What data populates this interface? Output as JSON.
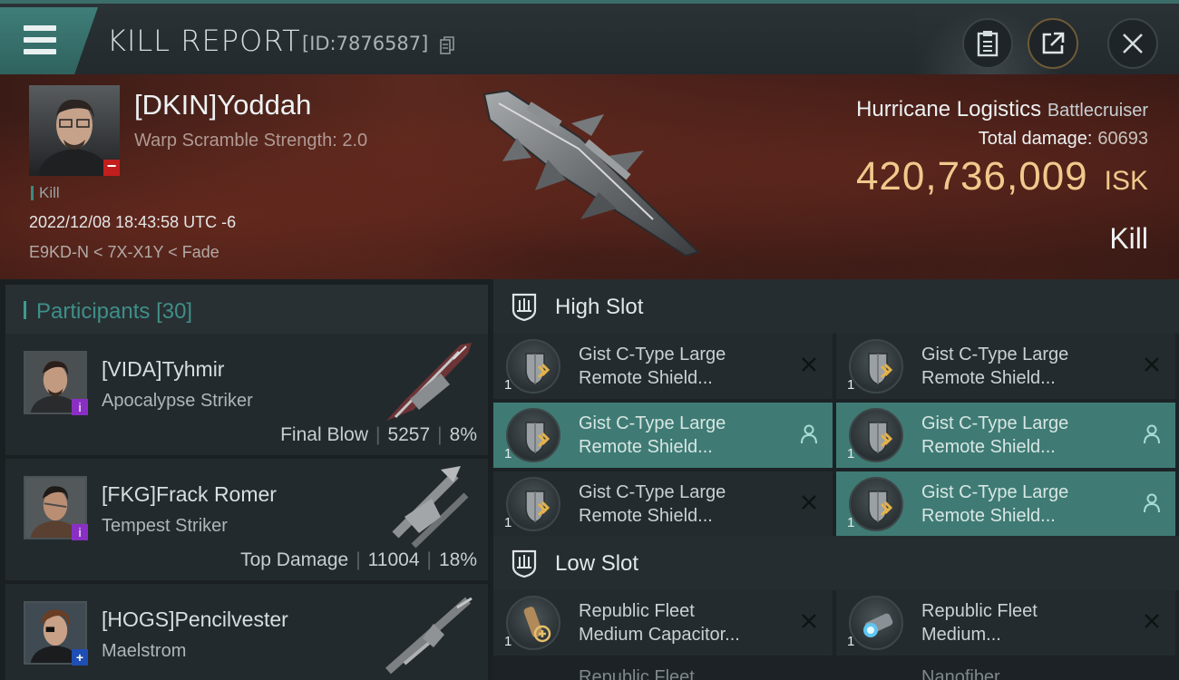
{
  "header": {
    "title": "KILL REPORT",
    "report_id": "[ID:7876587]",
    "icons": [
      "menu-icon",
      "copy-icon",
      "clipboard-icon",
      "export-icon",
      "close-icon"
    ]
  },
  "victim": {
    "name": "[DKIN]Yoddah",
    "warp_scramble": "Warp Scramble Strength: 2.0",
    "kill_tag": "Kill",
    "datetime": "2022/12/08 18:43:58 UTC -6",
    "location": "E9KD-N < 7X-X1Y < Fade",
    "ship_name": "Hurricane Logistics",
    "ship_class": "Battlecruiser",
    "total_damage_label": "Total damage:",
    "total_damage": "60693",
    "isk_value": "420,736,009",
    "isk_unit": "ISK",
    "result": "Kill"
  },
  "participants": {
    "label": "Participants",
    "count": "[30]",
    "rows": [
      {
        "name": "[VIDA]Tyhmir",
        "ship": "Apocalypse Striker",
        "tag": "Final Blow",
        "damage": "5257",
        "percent": "8%",
        "badge": "purple"
      },
      {
        "name": "[FKG]Frack Romer",
        "ship": "Tempest Striker",
        "tag": "Top Damage",
        "damage": "11004",
        "percent": "18%",
        "badge": "purple"
      },
      {
        "name": "[HOGS]Pencilvester",
        "ship": "Maelstrom",
        "tag": "",
        "damage": "",
        "percent": "",
        "badge": "blue"
      }
    ]
  },
  "fitting": {
    "high_slot_label": "High Slot",
    "low_slot_label": "Low Slot",
    "high_slot": [
      {
        "line1": "Gist C-Type Large",
        "line2": "Remote Shield...",
        "qty": "1",
        "state": "destroyed"
      },
      {
        "line1": "Gist C-Type Large",
        "line2": "Remote Shield...",
        "qty": "1",
        "state": "destroyed"
      },
      {
        "line1": "Gist C-Type Large",
        "line2": "Remote Shield...",
        "qty": "1",
        "state": "dropped"
      },
      {
        "line1": "Gist C-Type Large",
        "line2": "Remote Shield...",
        "qty": "1",
        "state": "dropped"
      },
      {
        "line1": "Gist C-Type Large",
        "line2": "Remote Shield...",
        "qty": "1",
        "state": "destroyed"
      },
      {
        "line1": "Gist C-Type Large",
        "line2": "Remote Shield...",
        "qty": "1",
        "state": "dropped"
      }
    ],
    "low_slot": [
      {
        "line1": "Republic Fleet",
        "line2": "Medium Capacitor...",
        "qty": "1",
        "state": "destroyed"
      },
      {
        "line1": "Republic Fleet",
        "line2": "Medium...",
        "qty": "1",
        "state": "destroyed"
      }
    ],
    "cutoff_left": "Republic Fleet",
    "cutoff_right": "Nanofiber"
  },
  "colors": {
    "accent": "#3f7b74",
    "isk": "#f0c98c",
    "banner": "#5a281e",
    "purple_badge": "#8a2fc4",
    "blue_badge": "#1f4fb6"
  }
}
